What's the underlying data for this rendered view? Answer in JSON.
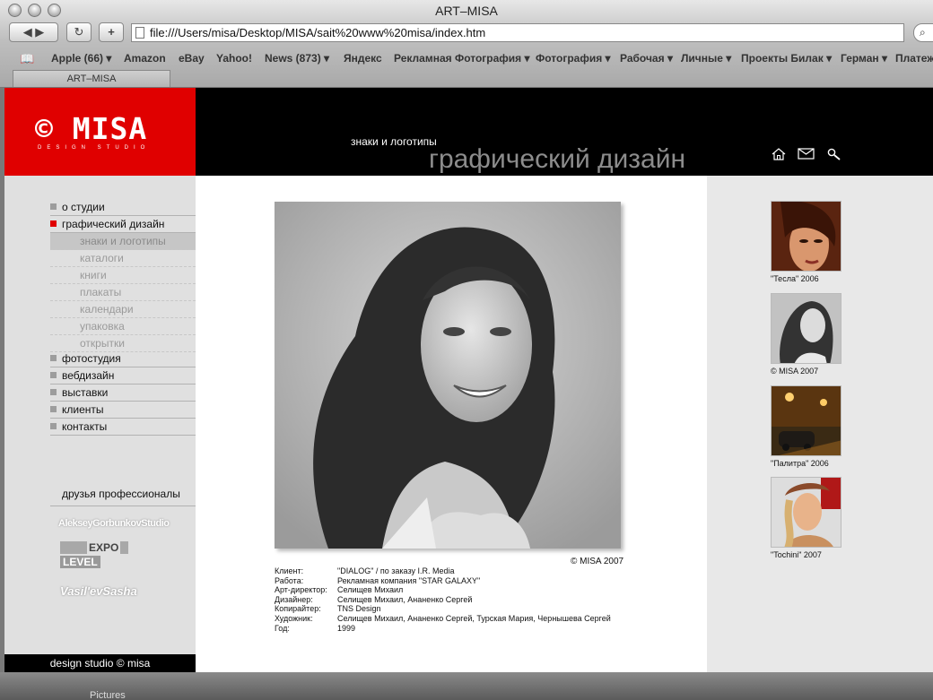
{
  "window": {
    "title": "ART–MISA"
  },
  "toolbar": {
    "back": "◀ ▶",
    "reload": "↻",
    "add": "+",
    "url": "file:///Users/misa/Desktop/MISA/sait%20www%20misa/index.htm"
  },
  "bookmarks": [
    "Apple (66) ▾",
    "Amazon",
    "eBay",
    "Yahoo!",
    "News (873) ▾",
    "Яндекс",
    "Рекламная Фотография ▾",
    "Фотография ▾",
    "Рабочая ▾",
    "Личные ▾",
    "Проекты Билак ▾",
    "Герман ▾",
    "Платеж"
  ],
  "tab": {
    "label": "ART–MISA"
  },
  "logo": {
    "main": "© MISA",
    "sub": "DESIGN STUDIO"
  },
  "header": {
    "subtitle": "знаки и логотипы",
    "title": "графический дизайн"
  },
  "menu": {
    "items": [
      {
        "label": "о студии",
        "active": false
      },
      {
        "label": "графический дизайн",
        "active": true
      }
    ],
    "sub": [
      "знаки и логотипы",
      "каталоги",
      "книги",
      "плакаты",
      "календари",
      "упаковка",
      "открытки"
    ],
    "items2": [
      "фотостудия",
      "вебдизайн",
      "выставки",
      "клиенты",
      "контакты"
    ]
  },
  "friends": {
    "title": "друзья профессионалы",
    "p1": "AlekseyGorbunkovStudio",
    "p2a": "EXPO",
    "p2b": "LEVEL",
    "p3": "Vasil'evSasha"
  },
  "footer": {
    "text": "design studio © misa"
  },
  "photo": {
    "copyright": "© MISA 2007"
  },
  "credits": [
    {
      "k": "Клиент:",
      "v": "\"DIALOG\" / по заказу I.R. Media"
    },
    {
      "k": "Работа:",
      "v": "Рекламная компания \"STAR GALAXY\""
    },
    {
      "k": "Арт-директор:",
      "v": "Селищев Михаил"
    },
    {
      "k": "Дизайнер:",
      "v": "Селищев Михаил, Ананенко Сергей"
    },
    {
      "k": "Копирайтер:",
      "v": "TNS Design"
    },
    {
      "k": "Художник:",
      "v": "Селищев Михаил, Ананенко Сергей, Турская Мария, Чернышева Сергей"
    },
    {
      "k": "Год:",
      "v": "1999"
    }
  ],
  "thumbs": [
    {
      "caption": "\"Тесла\" 2006"
    },
    {
      "caption": "© MISA 2007"
    },
    {
      "caption": "\"Палитра\" 2006"
    },
    {
      "caption": "\"Tochini\" 2007"
    }
  ],
  "dock": {
    "label": "Pictures"
  }
}
